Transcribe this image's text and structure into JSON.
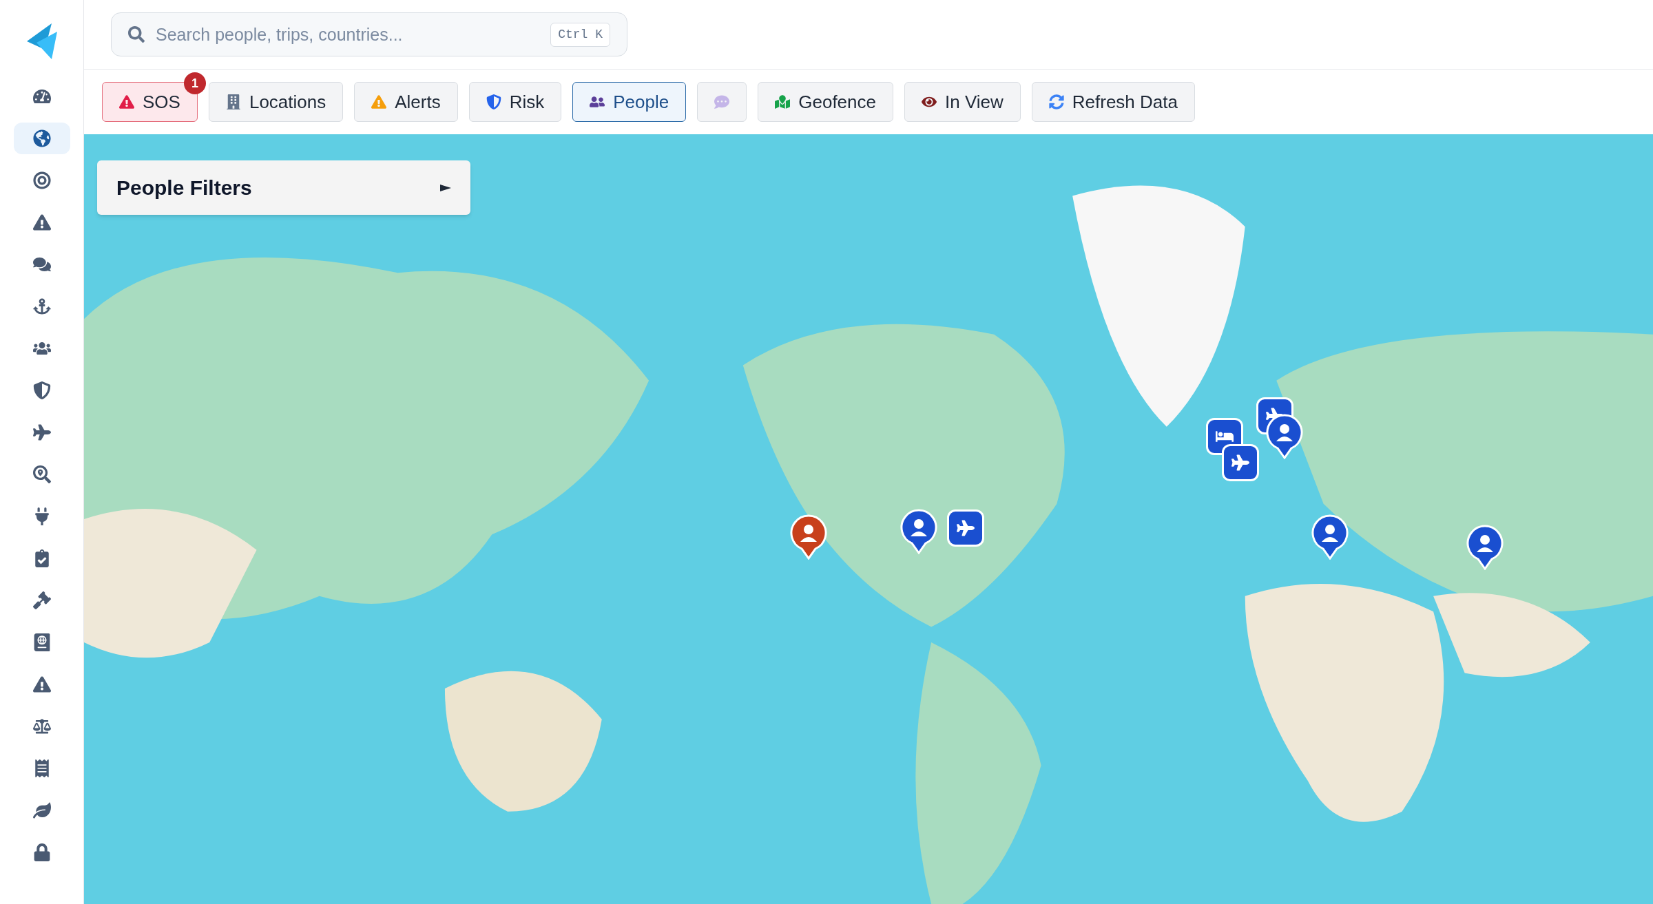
{
  "sidebar": {
    "items": [
      {
        "kind": "dashboard",
        "selected": false
      },
      {
        "kind": "globe",
        "selected": true
      },
      {
        "kind": "target",
        "selected": false
      },
      {
        "kind": "warning",
        "selected": false
      },
      {
        "kind": "chat",
        "selected": false
      },
      {
        "kind": "anchor",
        "selected": false
      },
      {
        "kind": "users",
        "selected": false
      },
      {
        "kind": "shield",
        "selected": false
      },
      {
        "kind": "plane",
        "selected": false
      },
      {
        "kind": "search-location",
        "selected": false
      },
      {
        "kind": "plug",
        "selected": false
      },
      {
        "kind": "clipboard",
        "selected": false
      },
      {
        "kind": "gavel",
        "selected": false
      },
      {
        "kind": "passport",
        "selected": false
      },
      {
        "kind": "warning",
        "selected": false
      },
      {
        "kind": "scale",
        "selected": false
      },
      {
        "kind": "receipt",
        "selected": false
      },
      {
        "kind": "leaf",
        "selected": false
      },
      {
        "kind": "lock",
        "selected": false
      }
    ]
  },
  "search": {
    "placeholder": "Search people, trips, countries...",
    "shortcut": "Ctrl K"
  },
  "tabs": [
    {
      "kind": "sos",
      "label": "SOS",
      "badge": "1",
      "selected": false
    },
    {
      "kind": "locations",
      "label": "Locations",
      "selected": false
    },
    {
      "kind": "alerts",
      "label": "Alerts",
      "selected": false
    },
    {
      "kind": "risk",
      "label": "Risk",
      "selected": false
    },
    {
      "kind": "people",
      "label": "People",
      "selected": true
    },
    {
      "kind": "chat",
      "selected": false
    },
    {
      "kind": "geofence",
      "label": "Geofence",
      "selected": false
    },
    {
      "kind": "in-view",
      "label": "In View",
      "selected": false
    },
    {
      "kind": "refresh",
      "label": "Refresh Data",
      "selected": false
    }
  ],
  "filters_panel": {
    "title": "People Filters"
  },
  "map": {
    "markers": [
      {
        "kind": "person",
        "color": "#c8401b"
      },
      {
        "kind": "person",
        "color": "#1a4fd0"
      },
      {
        "kind": "plane",
        "color": "#1a4fd0"
      },
      {
        "kind": "bed",
        "color": "#1a4fd0"
      },
      {
        "kind": "plane",
        "color": "#1a4fd0"
      },
      {
        "kind": "person",
        "color": "#1a4fd0"
      },
      {
        "kind": "plane",
        "color": "#1a4fd0"
      },
      {
        "kind": "person",
        "color": "#1a4fd0"
      },
      {
        "kind": "person",
        "color": "#1a4fd0"
      }
    ]
  }
}
